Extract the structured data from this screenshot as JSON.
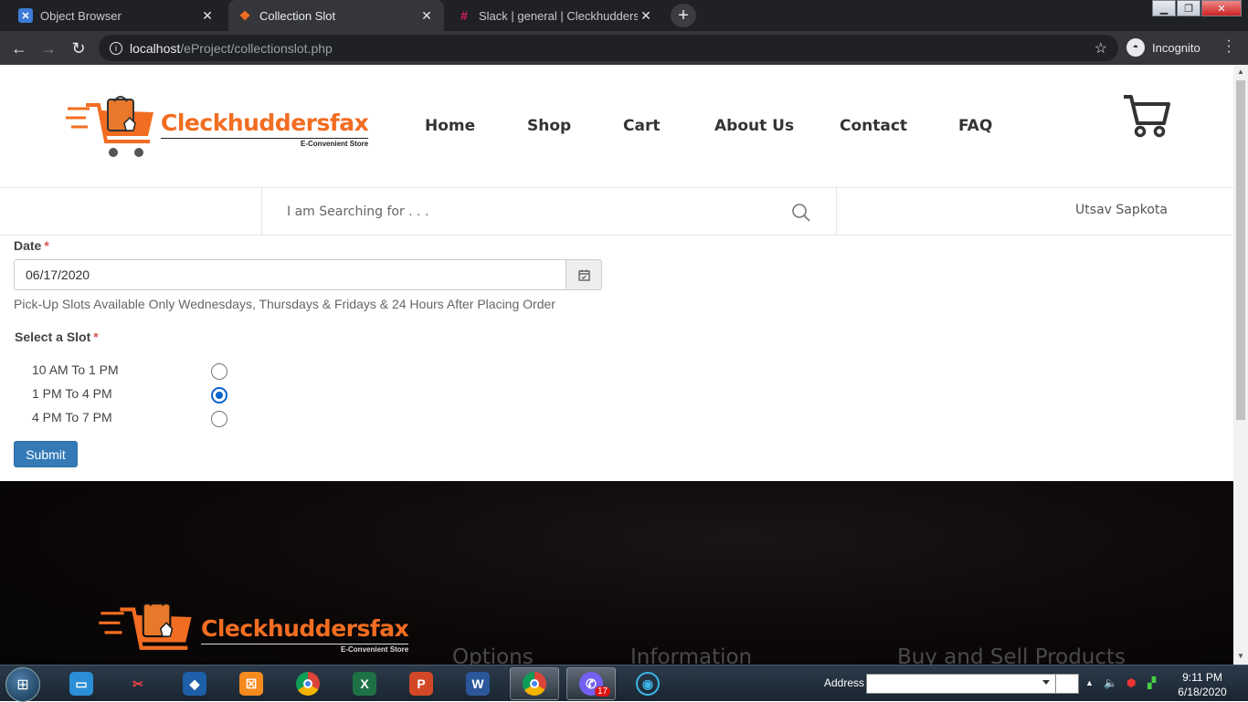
{
  "browser": {
    "tabs": [
      {
        "label": "Object Browser",
        "icon": "xampp-icon",
        "active": false
      },
      {
        "label": "Collection Slot",
        "icon": "php-icon",
        "active": true
      },
      {
        "label": "Slack | general | Cleckhuddersfax",
        "icon": "slack-icon",
        "active": false
      }
    ],
    "url_host": "localhost",
    "url_path": "/eProject/collectionslot.php",
    "incognito_label": "Incognito"
  },
  "site": {
    "brand_name": "Cleckhuddersfax",
    "brand_tagline": "E-Convenient Store",
    "nav": [
      "Home",
      "Shop",
      "Cart",
      "About Us",
      "Contact",
      "FAQ"
    ],
    "search_placeholder": "I am Searching for . . .",
    "user_name": "Utsav Sapkota"
  },
  "form": {
    "date_label": "Date",
    "date_value": "06/17/2020",
    "required_mark": "*",
    "help_text": "Pick-Up Slots Available Only Wednesdays, Thursdays & Fridays & 24 Hours After Placing Order",
    "slot_label": "Select a Slot",
    "slots": [
      {
        "label": "10 AM To 1 PM",
        "checked": false
      },
      {
        "label": "1 PM To 4 PM",
        "checked": true
      },
      {
        "label": "4 PM To 7 PM",
        "checked": false
      }
    ],
    "submit_label": "Submit"
  },
  "footer": {
    "brand_name": "Cleckhuddersfax",
    "brand_tagline": "E-Convenient Store",
    "headings": [
      "Options",
      "Information",
      "Buy and Sell Products"
    ]
  },
  "taskbar": {
    "address_label": "Address",
    "time": "9:11 PM",
    "date": "6/18/2020",
    "viber_badge": "17"
  },
  "colors": {
    "brand_orange": "#f26d21",
    "primary_button": "#337ab7",
    "radio_checked": "#0b63ce"
  }
}
